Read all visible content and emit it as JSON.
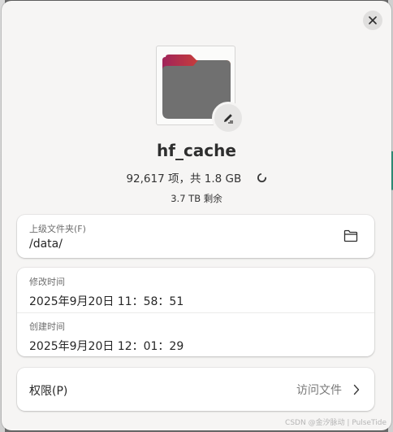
{
  "dialog": {
    "name": "hf_cache",
    "summary": "92,617 项，共 1.8 GB",
    "free_space": "3.7 TB 剩余"
  },
  "parent_folder": {
    "label": "上级文件夹(F)",
    "value": "/data/"
  },
  "times": {
    "modified_label": "修改时间",
    "modified_value": "2025年9月20日 11：58：51",
    "created_label": "创建时间",
    "created_value": "2025年9月20日 12：01：29"
  },
  "permissions": {
    "label": "权限(P)",
    "value": "访问文件"
  },
  "watermark": "CSDN @金汐脉动 | PulseTide",
  "colors": {
    "folder_body": "#6f6f6f",
    "folder_tab_start": "#a0245a",
    "folder_tab_end": "#e95420"
  },
  "icons": {
    "close": "close-icon",
    "edit": "pencil-icon",
    "spinner": "loading-spinner-icon",
    "open_folder": "folder-open-icon",
    "chevron": "chevron-right-icon",
    "folder": "folder-icon"
  }
}
